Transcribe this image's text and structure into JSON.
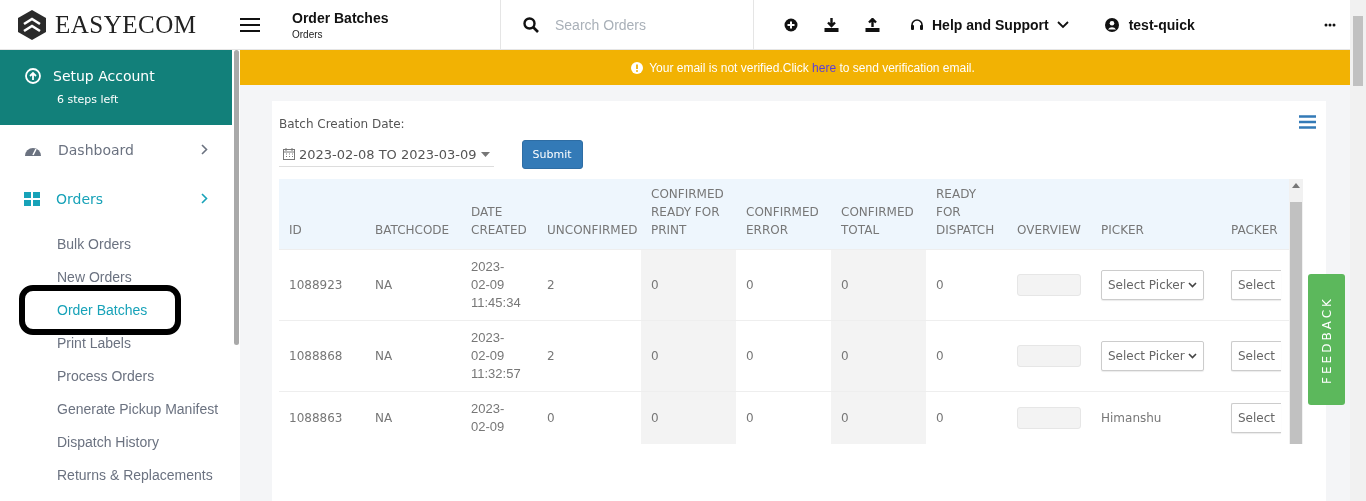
{
  "brand": "EASYECOM",
  "header": {
    "title": "Order Batches",
    "subtitle": "Orders"
  },
  "search": {
    "placeholder": "Search Orders"
  },
  "help": {
    "label": "Help and Support"
  },
  "user": {
    "name": "test-quick"
  },
  "setup": {
    "title": "Setup Account",
    "subtitle": "6 steps left"
  },
  "nav": [
    {
      "label": "Dashboard",
      "selected": false
    },
    {
      "label": "Orders",
      "selected": true,
      "children": [
        {
          "label": "Bulk Orders",
          "selected": false,
          "circled": false
        },
        {
          "label": "New Orders",
          "selected": false,
          "circled": false
        },
        {
          "label": "Order Batches",
          "selected": true,
          "circled": true
        },
        {
          "label": "Print Labels",
          "selected": false,
          "circled": false
        },
        {
          "label": "Process Orders",
          "selected": false,
          "circled": false
        },
        {
          "label": "Generate Pickup Manifest",
          "selected": false,
          "circled": false
        },
        {
          "label": "Dispatch History",
          "selected": false,
          "circled": false
        },
        {
          "label": "Returns & Replacements",
          "selected": false,
          "circled": false
        }
      ]
    }
  ],
  "banner": {
    "before": "Your email is not verified.Click ",
    "link": "here",
    "after": " to send verification email."
  },
  "filter": {
    "label": "Batch Creation Date:",
    "date_range": "2023-02-08 TO 2023-03-09",
    "submit": "Submit"
  },
  "table": {
    "columns": [
      "ID",
      "BATCHCODE",
      "DATE CREATED",
      "UNCONFIRMED",
      "CONFIRMED READY FOR PRINT",
      "CONFIRMED ERROR",
      "CONFIRMED TOTAL",
      "READY FOR DISPATCH",
      "OVERVIEW",
      "PICKER",
      "PACKER"
    ],
    "rows": [
      {
        "id": "1088923",
        "batchcode": "NA",
        "date": "2023-02-09 11:45:34",
        "unconfirmed": "2",
        "ready_for_print": "0",
        "error": "0",
        "total": "0",
        "ready_for_dispatch": "0",
        "picker": {
          "kind": "select",
          "text": "Select Picker"
        },
        "packer": {
          "kind": "select",
          "text": "Select"
        }
      },
      {
        "id": "1088868",
        "batchcode": "NA",
        "date": "2023-02-09 11:32:57",
        "unconfirmed": "2",
        "ready_for_print": "0",
        "error": "0",
        "total": "0",
        "ready_for_dispatch": "0",
        "picker": {
          "kind": "select",
          "text": "Select Picker"
        },
        "packer": {
          "kind": "select",
          "text": "Select"
        }
      },
      {
        "id": "1088863",
        "batchcode": "NA",
        "date": "2023-02-09",
        "unconfirmed": "0",
        "ready_for_print": "0",
        "error": "0",
        "total": "0",
        "ready_for_dispatch": "0",
        "picker": {
          "kind": "text",
          "text": "Himanshu"
        },
        "packer": {
          "kind": "select",
          "text": "Select"
        }
      }
    ]
  },
  "feedback": "FEEDBACK"
}
